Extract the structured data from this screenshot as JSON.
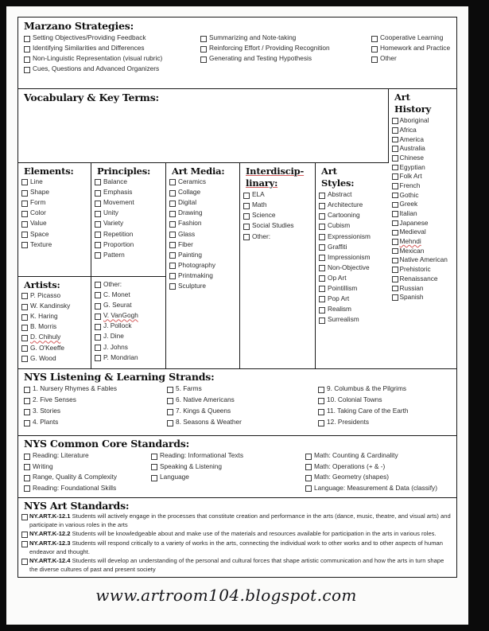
{
  "marzano": {
    "title": "Marzano Strategies:",
    "col1": [
      "Setting Objectives/Providing Feedback",
      "Identifying Similarities and Differences",
      "Non-Linguistic Representation (visual rubric)",
      "Cues, Questions and Advanced Organizers"
    ],
    "col2": [
      "Summarizing and Note-taking",
      "Reinforcing Effort / Providing Recognition",
      "Generating and Testing Hypothesis"
    ],
    "col3": [
      "Cooperative Learning",
      "Homework and Practice",
      "Other"
    ]
  },
  "vocabulary": {
    "title": "Vocabulary & Key Terms:"
  },
  "art_history": {
    "title_line1": "Art",
    "title_line2": "History",
    "items": [
      "Aboriginal",
      "Africa",
      "America",
      "Australia",
      "Chinese",
      "Egyptian",
      "Folk Art",
      "French",
      "Gothic",
      "Greek",
      "Italian",
      "Japanese",
      "Medieval",
      "Mehndi",
      "Mexican",
      "Native American",
      "Prehistoric",
      "Renaissance",
      "Russian",
      "Spanish"
    ]
  },
  "elements": {
    "title": "Elements:",
    "items": [
      "Line",
      "Shape",
      "Form",
      "Color",
      "Value",
      "Space",
      "Texture"
    ]
  },
  "principles": {
    "title": "Principles:",
    "items": [
      "Balance",
      "Emphasis",
      "Movement",
      "Unity",
      "Variety",
      "Repetition",
      "Proportion",
      "Pattern"
    ]
  },
  "artists": {
    "title": "Artists:",
    "items": [
      "P. Picasso",
      "W. Kandinsky",
      "K. Haring",
      "B. Morris",
      "D. Chihuly",
      "G. O'Keeffe",
      "G. Wood"
    ],
    "other_label": "Other:",
    "other_items": [
      "C. Monet",
      "G. Seurat",
      "V. VanGogh",
      "J. Pollock",
      "J. Dine",
      "J. Johns",
      "P. Mondrian"
    ]
  },
  "art_media": {
    "title": "Art Media:",
    "items": [
      "Ceramics",
      "Collage",
      "Digital",
      "Drawing",
      "Fashion",
      "Glass",
      "Fiber",
      "Painting",
      "Photography",
      "Printmaking",
      "Sculpture"
    ]
  },
  "interdisciplinary": {
    "title_line1": "Interdiscip-",
    "title_line2": "linary:",
    "items": [
      "ELA",
      "Math",
      "Science",
      "Social Studies",
      "Other:"
    ]
  },
  "art_styles": {
    "title_line1": "Art",
    "title_line2": "Styles:",
    "items": [
      "Abstract",
      "Architecture",
      "Cartooning",
      "Cubism",
      "Expressionism",
      "Graffiti",
      "Impressionism",
      "Non-Objective",
      "Op Art",
      "Pointillism",
      "Pop Art",
      "Realism",
      "Surrealism"
    ]
  },
  "listening_strands": {
    "title": "NYS Listening & Learning Strands:",
    "col1": [
      "1. Nursery Rhymes & Fables",
      "2. Five Senses",
      "3. Stories",
      "4. Plants"
    ],
    "col2": [
      "5. Farms",
      "6. Native Americans",
      "7. Kings & Queens",
      "8. Seasons & Weather"
    ],
    "col3": [
      "9. Columbus & the Pilgrims",
      "10. Colonial Towns",
      "11. Taking Care of the Earth",
      "12. Presidents"
    ]
  },
  "common_core": {
    "title": "NYS Common Core Standards:",
    "col1": [
      "Reading: Literature",
      "Writing",
      "Range, Quality & Complexity",
      "Reading: Foundational Skills"
    ],
    "col2": [
      "Reading: Informational Texts",
      "Speaking & Listening",
      "Language"
    ],
    "col3": [
      "Math: Counting & Cardinality",
      "Math: Operations (+ & -)",
      "Math:  Geometry (shapes)",
      "Language: Measurement & Data (classify)"
    ]
  },
  "art_standards": {
    "title": "NYS Art Standards:",
    "items": [
      {
        "code": "NY.ART.K-12.1",
        "text": "Students will actively engage in the processes that constitute creation and performance in the arts (dance, music, theatre, and visual arts) and participate in various roles in the arts"
      },
      {
        "code": "NY.ART.K-12.2",
        "text": "Students will be knowledgeable about and make use of the materials and resources available for participation in the arts in various roles."
      },
      {
        "code": "NY.ART.K-12.3",
        "text": "Students will respond critically to a variety of works in the arts, connecting the individual work to other works and to other aspects of human endeavor and thought."
      },
      {
        "code": "NY.ART.K-12.4",
        "text": "Students will develop an understanding of the personal and cultural forces that shape artistic communication and how the arts in turn shape the diverse cultures of past and present society"
      }
    ]
  },
  "footer": {
    "url": "www.artroom104.blogspot.com"
  },
  "colors": {
    "ink": "#1a1a1a",
    "squiggle": "#d45b5b",
    "paper": "#ffffff",
    "frame": "#0b0b0b"
  }
}
